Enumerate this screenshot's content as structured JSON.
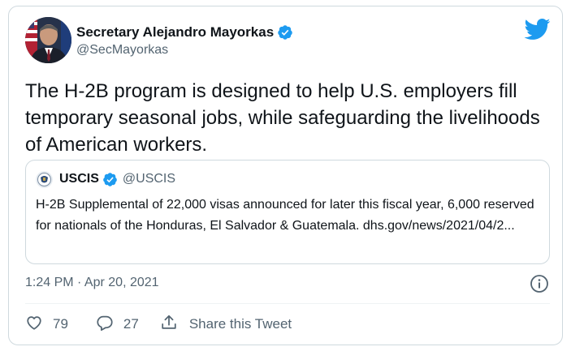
{
  "author": {
    "name": "Secretary Alejandro Mayorkas",
    "handle": "@SecMayorkas",
    "verified": true,
    "avatar": "person-portrait-avatar"
  },
  "brand_icon": "twitter-bird-icon",
  "tweet": {
    "text": "The H-2B program is designed to help U.S. employers fill temporary seasonal jobs, while safeguarding the livelihoods of American workers."
  },
  "quoted_tweet": {
    "name": "USCIS",
    "handle": "@USCIS",
    "verified": true,
    "avatar": "uscis-seal-avatar",
    "text": "H-2B Supplemental of 22,000 visas announced for later this fiscal year, 6,000 reserved for nationals of the Honduras, El Salvador & Guatemala. dhs.gov/news/2021/04/2..."
  },
  "timestamp": "1:24 PM · Apr 20, 2021",
  "actions": {
    "like_count": "79",
    "reply_count": "27",
    "share_label": "Share this Tweet"
  },
  "colors": {
    "accent": "#1d9bf0",
    "text_primary": "#0f1419",
    "text_secondary": "#536471",
    "border": "#cfd9de"
  }
}
